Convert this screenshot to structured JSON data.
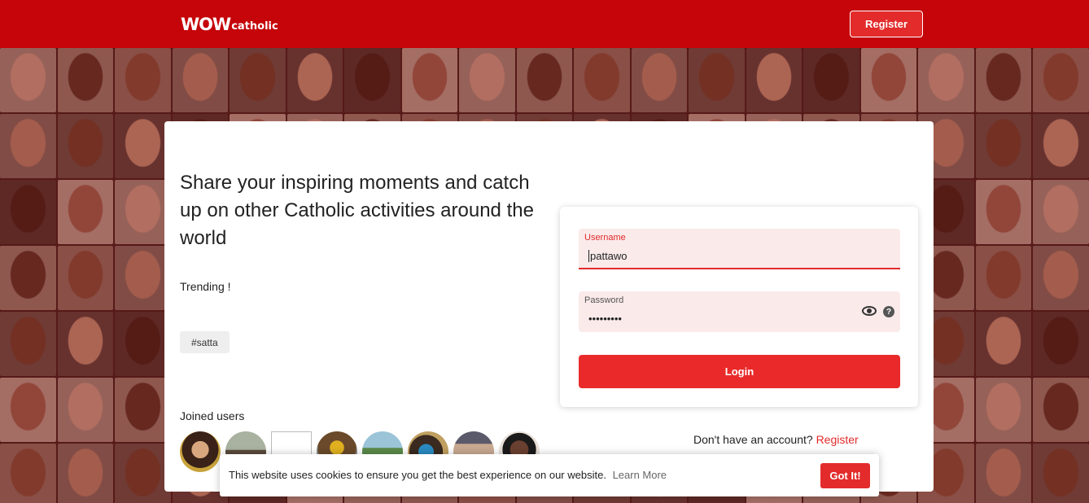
{
  "header": {
    "logo_big": "WOW",
    "logo_small": "catholic",
    "register_label": "Register"
  },
  "hero": {
    "headline": "Share your inspiring moments and catch up on other Catholic activities around the world",
    "trending_label": "Trending !",
    "trending_tags": [
      "#satta"
    ],
    "joined_label": "Joined users"
  },
  "login": {
    "username_label": "Username",
    "username_value": "pattawo",
    "password_label": "Password",
    "password_value": "•••••••••",
    "login_label": "Login",
    "help_glyph": "?",
    "no_account_text": "Don't have an account?",
    "register_link": "Register"
  },
  "cookie": {
    "message": "This website uses cookies to ensure you get the best experience on our website.",
    "learn_more": "Learn More",
    "accept_label": "Got It!"
  },
  "colors": {
    "brand_red": "#c50509",
    "button_red": "#ea2a2a",
    "field_bg": "#faeaea"
  }
}
